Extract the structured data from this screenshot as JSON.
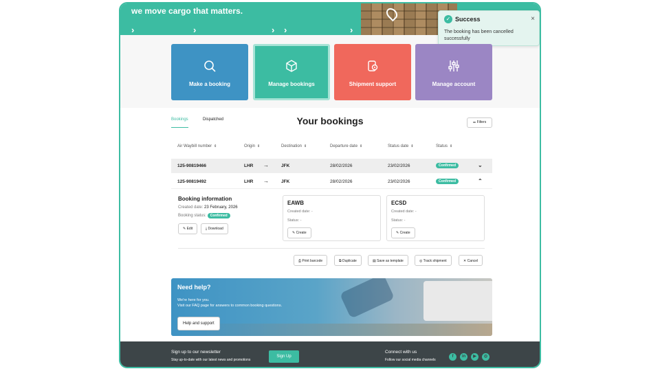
{
  "hero": {
    "tagline": "we move cargo that matters."
  },
  "toast": {
    "title": "Success",
    "message": "The booking has been cancelled successfully",
    "close": "×"
  },
  "tiles": [
    {
      "label": "Make a booking",
      "color": "#3e93c4",
      "icon": "search-icon"
    },
    {
      "label": "Manage bookings",
      "color": "#3cbca2",
      "icon": "box-icon"
    },
    {
      "label": "Shipment support",
      "color": "#f0685c",
      "icon": "gear-icon"
    },
    {
      "label": "Manage account",
      "color": "#9b86c4",
      "icon": "sliders-icon"
    }
  ],
  "tabs": {
    "bookings": "Bookings",
    "dispatched": "Dispatched"
  },
  "page_title": "Your bookings",
  "filters_label": "Filters",
  "columns": [
    "Air Waybill number",
    "Origin",
    "Destination",
    "Departure date",
    "Status date",
    "Status"
  ],
  "rows": [
    {
      "awb": "125-90819466",
      "origin": "LHR",
      "arrow": "→",
      "dest": "JFK",
      "dep": "28/02/2026",
      "sdate": "23/02/2026",
      "status": "Confirmed",
      "toggle": "⌄"
    },
    {
      "awb": "125-90819492",
      "origin": "LHR",
      "arrow": "→",
      "dest": "JFK",
      "dep": "28/02/2026",
      "sdate": "23/02/2026",
      "status": "Confirmed",
      "toggle": "⌃"
    }
  ],
  "booking_info": {
    "title": "Booking information",
    "created_label": "Created date:",
    "created_value": "23 February, 2026",
    "status_label": "Booking status:",
    "status_value": "Confirmed",
    "edit": "Edit",
    "download": "Download"
  },
  "eawb": {
    "title": "EAWB",
    "created": "Created date: -",
    "status": "Status: -",
    "create": "Create"
  },
  "ecsd": {
    "title": "ECSD",
    "created": "Created date: -",
    "status": "Status: -",
    "create": "Create"
  },
  "actions": {
    "print": "Print barcode",
    "duplicate": "Duplicate",
    "template": "Save as template",
    "track": "Track shipment",
    "cancel": "Cancel"
  },
  "help": {
    "title": "Need help?",
    "line1": "We're here for you.",
    "line2": "Visit our FAQ page for answers to common booking questions.",
    "button": "Help and support"
  },
  "footer": {
    "newsletter_title": "Sign up to our newsletter",
    "newsletter_sub": "Stay up-to-date with our latest news and promotions",
    "signup": "Sign Up",
    "connect_title": "Connect with us",
    "connect_sub": "Follow our social media channels",
    "social": [
      "facebook-icon",
      "linkedin-icon",
      "youtube-icon",
      "instagram-icon"
    ]
  },
  "colors": {
    "accent": "#3cbca2",
    "blue": "#3e93c4",
    "red": "#f0685c",
    "purple": "#9b86c4",
    "footer": "#3d4548"
  }
}
